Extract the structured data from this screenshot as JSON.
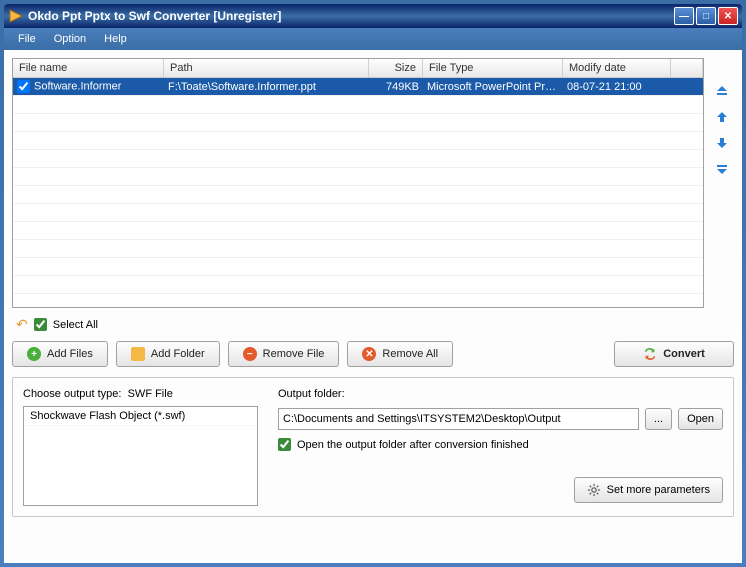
{
  "window": {
    "title": "Okdo Ppt Pptx to Swf Converter [Unregister]"
  },
  "menu": {
    "file": "File",
    "option": "Option",
    "help": "Help"
  },
  "table": {
    "headers": {
      "name": "File name",
      "path": "Path",
      "size": "Size",
      "type": "File Type",
      "date": "Modify date"
    },
    "rows": [
      {
        "checked": true,
        "name": "Software.Informer",
        "path": "F:\\Toate\\Software.Informer.ppt",
        "size": "749KB",
        "type": "Microsoft PowerPoint Pre...",
        "date": "08-07-21 21:00"
      }
    ]
  },
  "selectall": {
    "label": "Select All",
    "checked": true
  },
  "toolbar": {
    "add_files": "Add Files",
    "add_folder": "Add Folder",
    "remove_file": "Remove File",
    "remove_all": "Remove All",
    "convert": "Convert"
  },
  "output": {
    "type_label": "Choose output type:",
    "type_value": "SWF File",
    "type_option": "Shockwave Flash Object (*.swf)",
    "folder_label": "Output folder:",
    "folder_value": "C:\\Documents and Settings\\ITSYSTEM2\\Desktop\\Output",
    "browse": "...",
    "open": "Open",
    "open_after_label": "Open the output folder after conversion finished",
    "open_after_checked": true,
    "more_params": "Set more parameters"
  }
}
